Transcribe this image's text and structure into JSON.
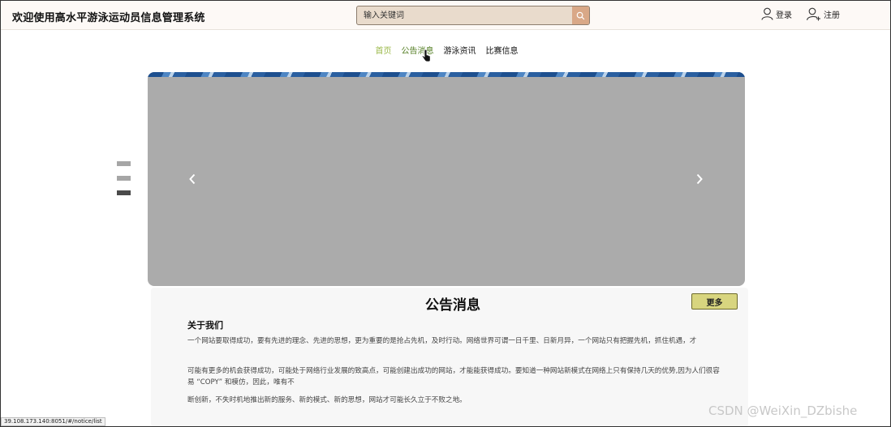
{
  "header": {
    "title": "欢迎使用高水平游泳运动员信息管理系统",
    "search_placeholder": "输入关键词",
    "search_icon": "search-icon",
    "login_label": "登录",
    "register_label": "注册"
  },
  "nav": {
    "items": [
      {
        "label": "首页"
      },
      {
        "label": "公告消息"
      },
      {
        "label": "游泳资讯"
      },
      {
        "label": "比赛信息"
      }
    ]
  },
  "carousel": {
    "indicator_count": 3,
    "active_index": 2
  },
  "notice": {
    "title": "公告消息",
    "more_label": "更多",
    "about_title": "关于我们",
    "paragraphs": [
      "一个网站要取得成功，要有先进的理念、先进的思想，更为重要的是抢占先机，及时行动。网络世界可谓一日千里、日新月异，一个网站只有把握先机，抓住机遇，才",
      "可能有更多的机会获得成功，可能处于网络行业发展的致高点，可能创建出成功的网站，才能能获得成功。要知道一种网站新模式在网络上只有保持几天的优势,因为人们很容易 “COPY” 和模仿，因此，唯有不",
      "断创新，不失时机地推出新的服务、新的模式、新的思想，网站才可能长久立于不败之地。"
    ]
  },
  "status_bar": {
    "url": "39.108.173.140:8051/#/notice/list"
  },
  "watermark": "CSDN @WeiXin_DZbishe",
  "colors": {
    "header_bg": "#fdf9f6",
    "search_bg": "#e9dbcc",
    "search_button": "#d9a887",
    "nav_home": "#9bb94a",
    "nav_active": "#4e7a1c",
    "carousel_bg": "#ababab",
    "more_button": "#d8d57f"
  }
}
